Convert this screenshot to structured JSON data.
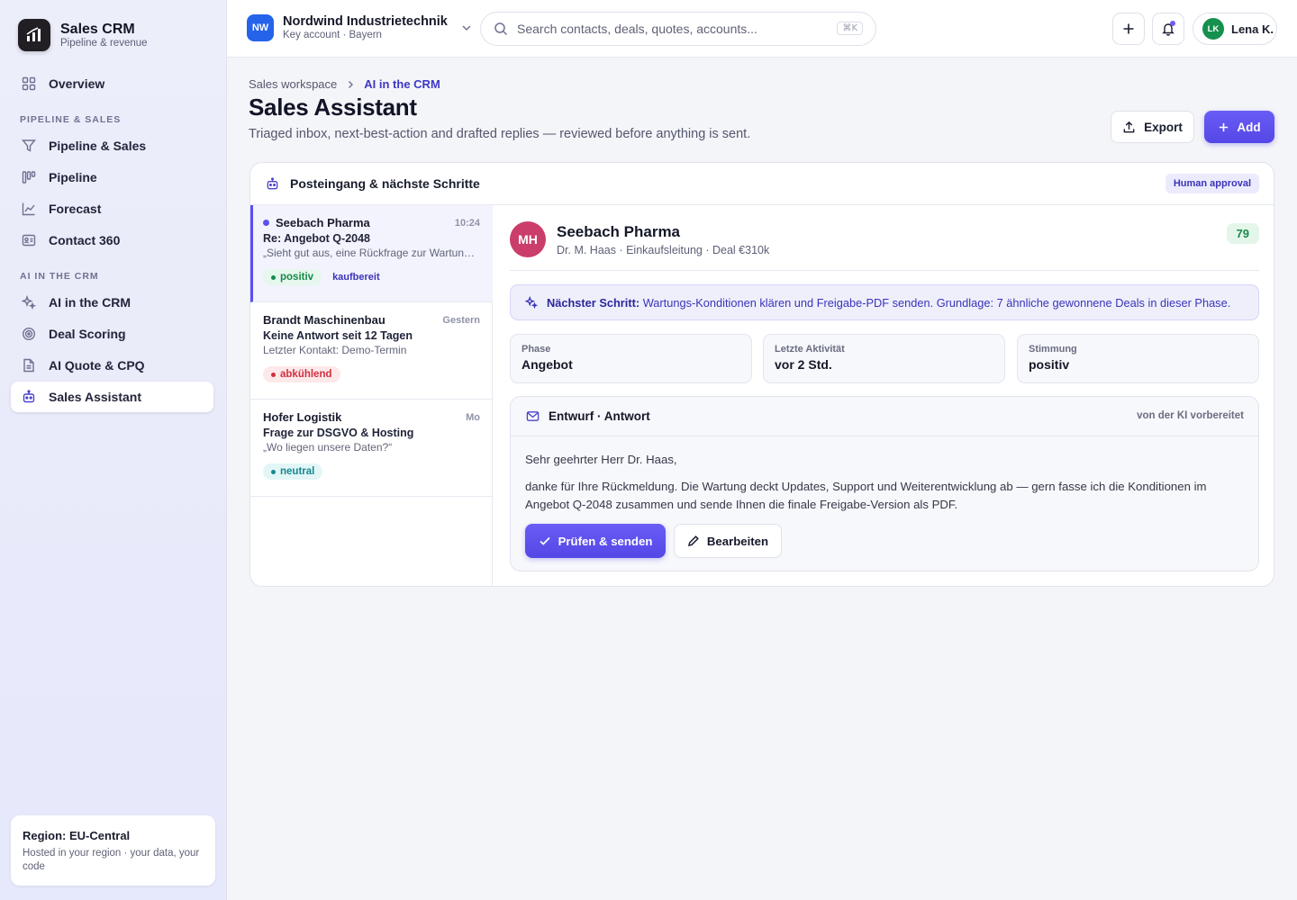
{
  "brand": {
    "title": "Sales CRM",
    "subtitle": "Pipeline & revenue"
  },
  "sidebar": {
    "overview": "Overview",
    "section_pipeline": "PIPELINE & SALES",
    "pipeline_sales": "Pipeline & Sales",
    "pipeline": "Pipeline",
    "forecast": "Forecast",
    "contact360": "Contact 360",
    "section_ai": "AI IN THE CRM",
    "ai_crm": "AI in the CRM",
    "deal_scoring": "Deal Scoring",
    "ai_quote": "AI Quote & CPQ",
    "sales_assistant": "Sales Assistant",
    "region": {
      "title": "Region: EU-Central",
      "text": "Hosted in your region · your data, your code"
    }
  },
  "topbar": {
    "account_initials": "NW",
    "account_name": "Nordwind Industrietechnik",
    "account_sub": "Key account · Bayern",
    "search_placeholder": "Search contacts, deals, quotes, accounts...",
    "search_shortcut": "⌘K",
    "user_initials": "LK",
    "user_name": "Lena K."
  },
  "header": {
    "crumb_root": "Sales workspace",
    "crumb_current": "AI in the CRM",
    "title": "Sales Assistant",
    "subtitle": "Triaged inbox, next-best-action and drafted replies — reviewed before anything is sent.",
    "export_label": "Export",
    "add_label": "Add"
  },
  "panel": {
    "title": "Posteingang & nächste Schritte",
    "badge": "Human approval"
  },
  "inbox": [
    {
      "from": "Seebach Pharma",
      "time": "10:24",
      "subject": "Re: Angebot Q-2048",
      "preview": "„Sieht gut aus, eine Rückfrage zur Wartung…",
      "tag": "positiv",
      "extra": "kaufbereit"
    },
    {
      "from": "Brandt Maschinenbau",
      "time": "Gestern",
      "subject": "Keine Antwort seit 12 Tagen",
      "preview": "Letzter Kontakt: Demo-Termin",
      "tag": "abkühlend"
    },
    {
      "from": "Hofer Logistik",
      "time": "Mo",
      "subject": "Frage zur DSGVO & Hosting",
      "preview": "„Wo liegen unsere Daten?“",
      "tag": "neutral"
    }
  ],
  "detail": {
    "initials": "MH",
    "name": "Seebach Pharma",
    "meta": "Dr. M. Haas · Einkaufsleitung · Deal €310k",
    "score": "79",
    "next_label": "Nächster Schritt:",
    "next_text": "Wartungs-Konditionen klären und Freigabe-PDF senden. Grundlage: 7 ähnliche gewonnene Deals in dieser Phase.",
    "stats": [
      {
        "label": "Phase",
        "value": "Angebot"
      },
      {
        "label": "Letzte Aktivität",
        "value": "vor 2 Std."
      },
      {
        "label": "Stimmung",
        "value": "positiv"
      }
    ],
    "draft": {
      "title": "Entwurf · Antwort",
      "tag": "von der KI vorbereitet",
      "greeting": "Sehr geehrter Herr Dr. Haas,",
      "body": "danke für Ihre Rückmeldung. Die Wartung deckt Updates, Support und Weiterentwicklung ab — gern fasse ich die Konditionen im Angebot Q-2048 zusammen und sende Ihnen die finale Freigabe-Version als PDF.",
      "send_label": "Prüfen & senden",
      "edit_label": "Bearbeiten"
    }
  },
  "colors": {
    "accent": "#5447e6",
    "positive": "#168a4a",
    "negative": "#d0303f",
    "neutral": "#16878f"
  }
}
